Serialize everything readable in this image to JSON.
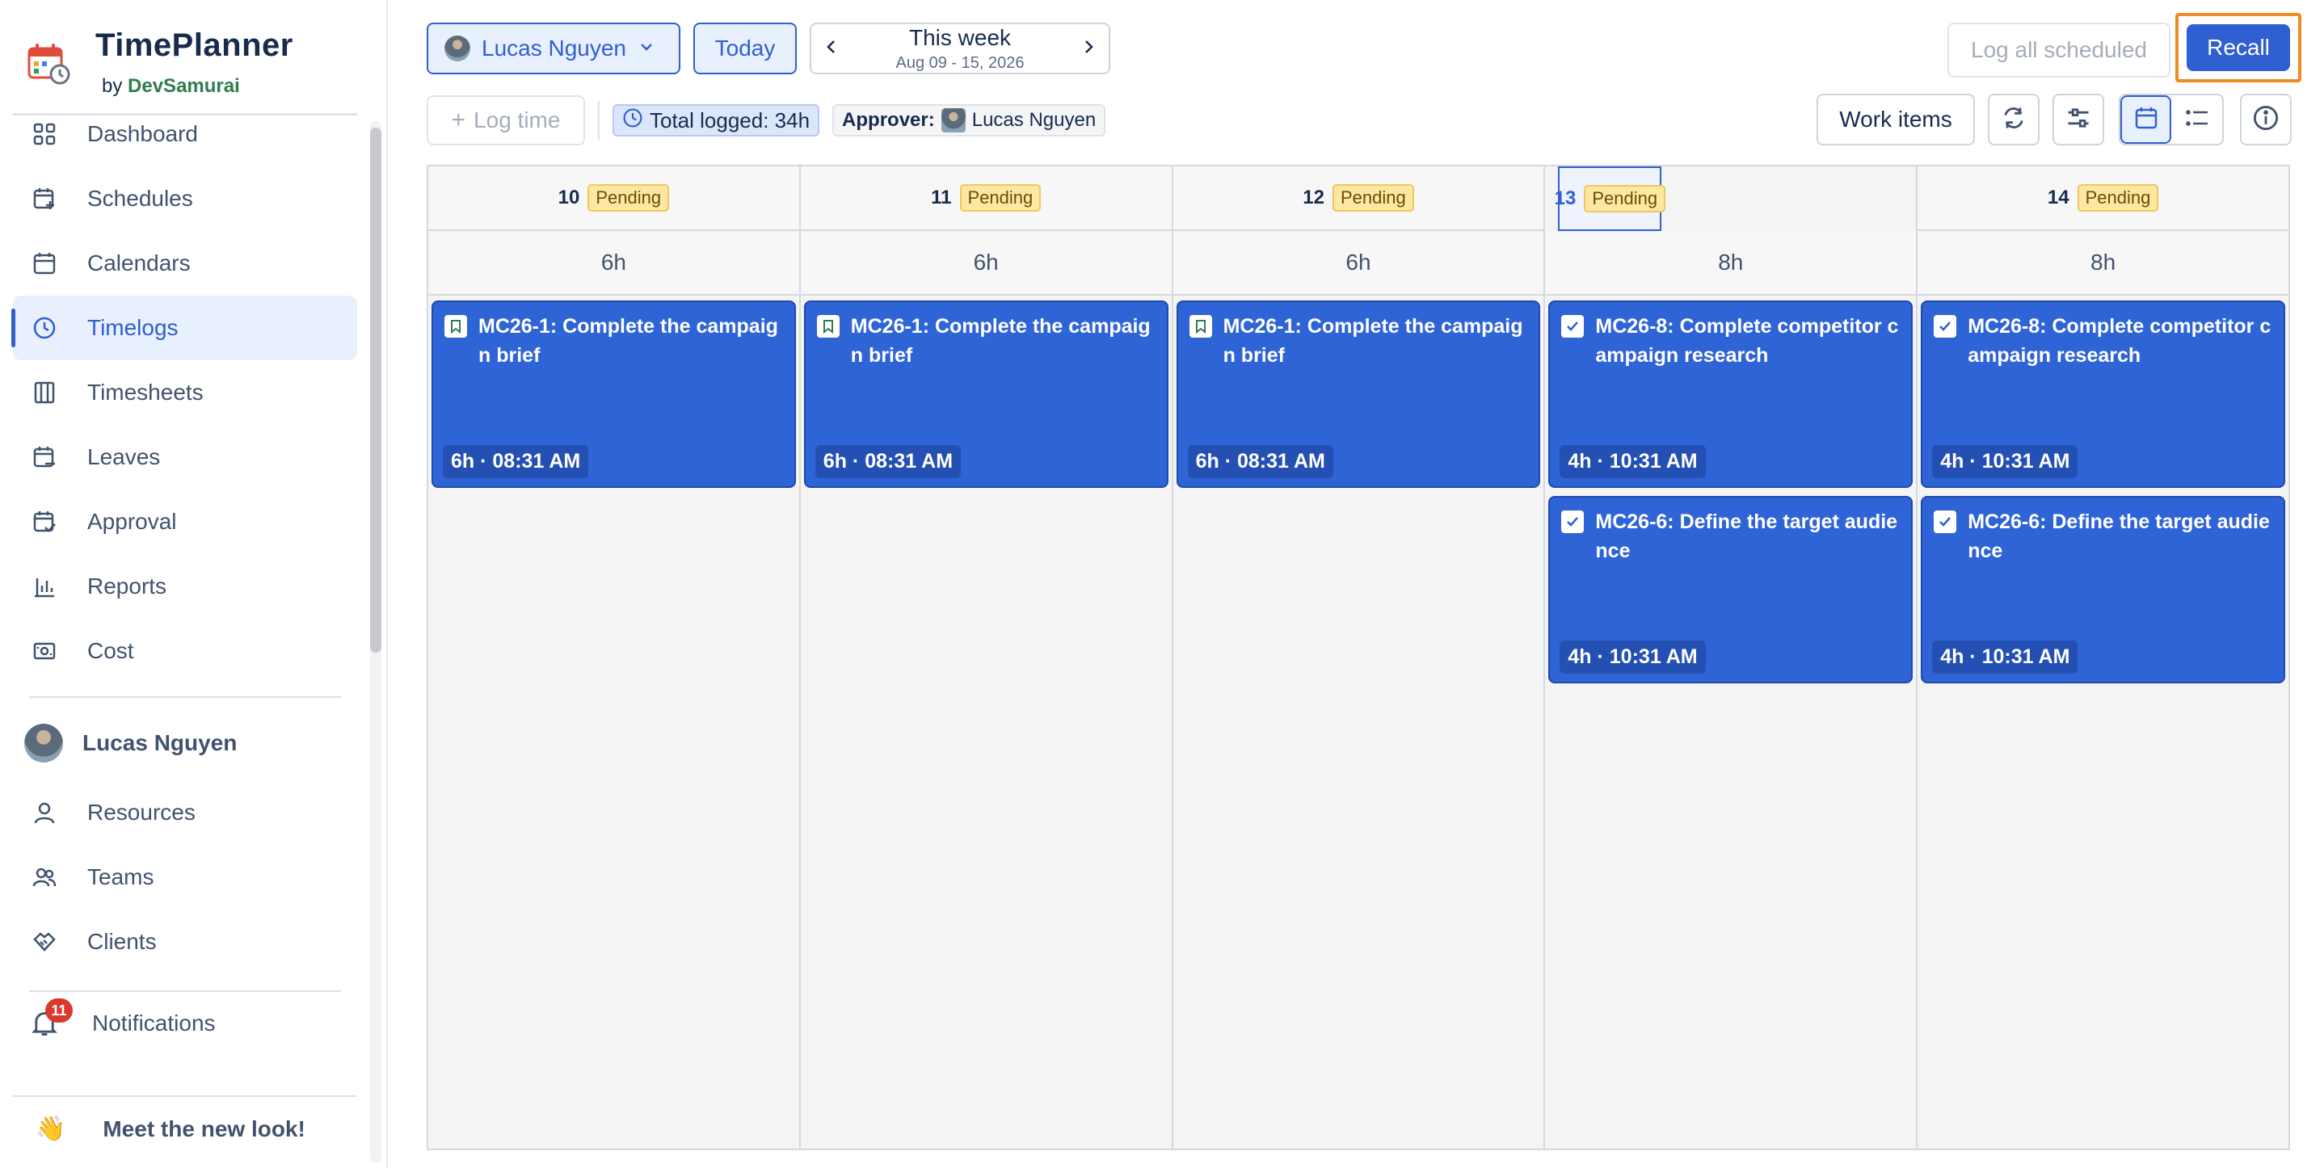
{
  "brand": {
    "title": "TimePlanner",
    "by": "by",
    "company": "DevSamurai"
  },
  "sidebar": {
    "items": [
      {
        "label": "Dashboard",
        "icon": "dashboard-icon"
      },
      {
        "label": "Schedules",
        "icon": "calendar-plus-icon"
      },
      {
        "label": "Calendars",
        "icon": "calendar-icon"
      },
      {
        "label": "Timelogs",
        "icon": "clock-icon",
        "active": true
      },
      {
        "label": "Timesheets",
        "icon": "columns-icon"
      },
      {
        "label": "Leaves",
        "icon": "calendar-minus-icon"
      },
      {
        "label": "Approval",
        "icon": "calendar-check-icon"
      },
      {
        "label": "Reports",
        "icon": "bar-chart-icon"
      },
      {
        "label": "Cost",
        "icon": "money-icon"
      }
    ],
    "user": "Lucas Nguyen",
    "user_items": [
      {
        "label": "Resources",
        "icon": "person-icon"
      },
      {
        "label": "Teams",
        "icon": "team-icon"
      },
      {
        "label": "Clients",
        "icon": "handshake-icon"
      }
    ],
    "notifications": {
      "label": "Notifications",
      "count": "11"
    },
    "meet": {
      "emoji": "👋",
      "label": "Meet the new look!"
    }
  },
  "toolbar": {
    "user_select": "Lucas Nguyen",
    "today": "Today",
    "week_title": "This week",
    "week_range": "Aug 09 - 15, 2026",
    "log_all": "Log all scheduled",
    "recall": "Recall",
    "log_time": "Log time",
    "total_logged": "Total logged: 34h",
    "approver_label": "Approver:",
    "approver_name": "Lucas Nguyen",
    "work_items": "Work items"
  },
  "days": [
    {
      "day": "10",
      "status": "Pending",
      "total": "6h",
      "entries": [
        {
          "title": "MC26-1: Complete the campaign brief",
          "time": "6h · 08:31 AM",
          "icon": "bookmark-icon"
        }
      ]
    },
    {
      "day": "11",
      "status": "Pending",
      "total": "6h",
      "entries": [
        {
          "title": "MC26-1: Complete the campaign brief",
          "time": "6h · 08:31 AM",
          "icon": "bookmark-icon"
        }
      ]
    },
    {
      "day": "12",
      "status": "Pending",
      "total": "6h",
      "entries": [
        {
          "title": "MC26-1: Complete the campaign brief",
          "time": "6h · 08:31 AM",
          "icon": "bookmark-icon"
        }
      ]
    },
    {
      "day": "13",
      "status": "Pending",
      "total": "8h",
      "today": true,
      "entries": [
        {
          "title": "MC26-8: Complete competitor campaign research",
          "time": "4h · 10:31 AM",
          "icon": "checkbox-icon"
        },
        {
          "title": "MC26-6: Define the target audience",
          "time": "4h · 10:31 AM",
          "icon": "checkbox-icon"
        }
      ]
    },
    {
      "day": "14",
      "status": "Pending",
      "total": "8h",
      "entries": [
        {
          "title": "MC26-8: Complete competitor campaign research",
          "time": "4h · 10:31 AM",
          "icon": "checkbox-icon"
        },
        {
          "title": "MC26-6: Define the target audience",
          "time": "4h · 10:31 AM",
          "icon": "checkbox-icon"
        }
      ]
    }
  ]
}
